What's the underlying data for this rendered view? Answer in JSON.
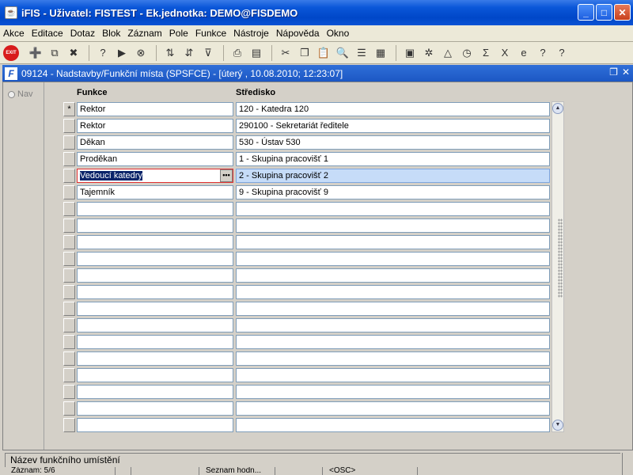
{
  "window": {
    "title": "iFIS - Uživatel: FISTEST - Ek.jednotka: DEMO@FISDEMO",
    "app_icon": "java-icon"
  },
  "menu": [
    "Akce",
    "Editace",
    "Dotaz",
    "Blok",
    "Záznam",
    "Pole",
    "Funkce",
    "Nástroje",
    "Nápověda",
    "Okno"
  ],
  "toolbar": {
    "exit_label": "EXIT"
  },
  "form": {
    "title": "09124 - Nadstavby/Funkční místa (SPSFCE) - [úterý  , 10.08.2010; 12:23:07]",
    "nav_label": "Nav",
    "col_funkce": "Funkce",
    "col_stredisko": "Středisko",
    "lov_glyph": "•••"
  },
  "rows": [
    {
      "indicator": "*",
      "funkce": "Rektor",
      "stredisko": "120 - Katedra 120"
    },
    {
      "indicator": "",
      "funkce": "Rektor",
      "stredisko": "290100 - Sekretariát ředitele"
    },
    {
      "indicator": "",
      "funkce": "Děkan",
      "stredisko": "530 - Ústav 530"
    },
    {
      "indicator": "",
      "funkce": "Proděkan",
      "stredisko": "1 - Skupina pracovišť 1"
    },
    {
      "indicator": "",
      "funkce": "Vedoucí katedry",
      "stredisko": "2 - Skupina pracovišť 2"
    },
    {
      "indicator": "",
      "funkce": "Tajemník",
      "stredisko": "9 - Skupina pracovišť 9"
    }
  ],
  "active_row": 4,
  "status": {
    "hint": "Název funkčního umístění",
    "record": "Záznam: 5/6",
    "list": "Seznam hodn...",
    "osc": "<OSC>"
  }
}
